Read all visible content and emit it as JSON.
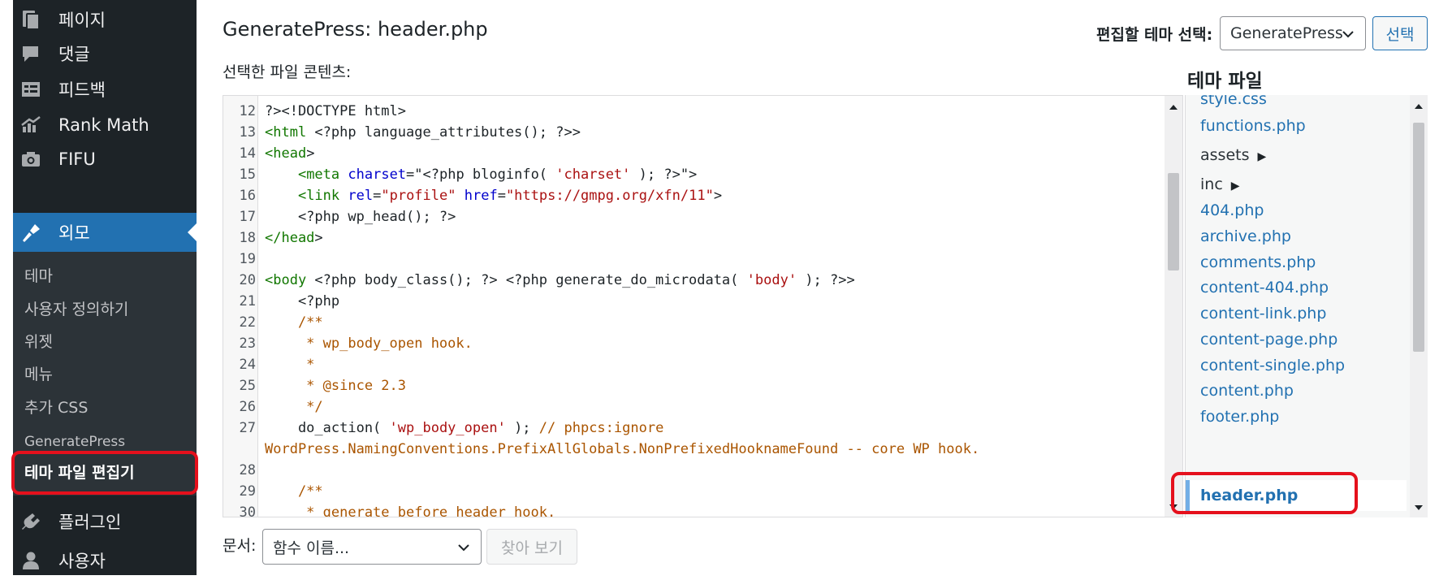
{
  "sidebar": {
    "top_items": [
      {
        "label": "페이지",
        "icon": "pages-icon"
      },
      {
        "label": "댓글",
        "icon": "comments-icon"
      },
      {
        "label": "피드백",
        "icon": "feedback-icon"
      },
      {
        "label": "Rank Math",
        "icon": "rank-math-icon"
      },
      {
        "label": "FIFU",
        "icon": "camera-icon"
      }
    ],
    "current": {
      "label": "외모",
      "icon": "appearance-brush-icon"
    },
    "submenu": [
      "테마",
      "사용자 정의하기",
      "위젯",
      "메뉴",
      "추가 CSS",
      "GeneratePress",
      "테마 파일 편집기"
    ],
    "bottom_items": [
      {
        "label": "플러그인",
        "icon": "plugins-icon"
      },
      {
        "label": "사용자",
        "icon": "users-icon"
      }
    ]
  },
  "header": {
    "title": "GeneratePress: header.php",
    "theme_select_label": "편집할 테마 선택:",
    "theme_select_value": "GeneratePress",
    "select_button": "선택"
  },
  "editor": {
    "label": "선택한 파일 콘텐츠:",
    "lines": [
      {
        "n": "12",
        "t": "?><!DOCTYPE html>"
      },
      {
        "n": "13",
        "t": "<html <?php language_attributes(); ?>>"
      },
      {
        "n": "14",
        "t": "<head>"
      },
      {
        "n": "15",
        "t": "    <meta charset=\"<?php bloginfo( 'charset' ); ?>\">"
      },
      {
        "n": "16",
        "t": "    <link rel=\"profile\" href=\"https://gmpg.org/xfn/11\">"
      },
      {
        "n": "17",
        "t": "    <?php wp_head(); ?>"
      },
      {
        "n": "18",
        "t": "</head>"
      },
      {
        "n": "19",
        "t": ""
      },
      {
        "n": "20",
        "t": "<body <?php body_class(); ?> <?php generate_do_microdata( 'body' ); ?>>"
      },
      {
        "n": "21",
        "t": "    <?php"
      },
      {
        "n": "22",
        "t": "    /**"
      },
      {
        "n": "23",
        "t": "     * wp_body_open hook."
      },
      {
        "n": "24",
        "t": "     *"
      },
      {
        "n": "25",
        "t": "     * @since 2.3"
      },
      {
        "n": "26",
        "t": "     */"
      },
      {
        "n": "27",
        "t": "    do_action( 'wp_body_open' ); // phpcs:ignore"
      },
      {
        "n": "",
        "t": "WordPress.NamingConventions.PrefixAllGlobals.NonPrefixedHooknameFound -- core WP hook."
      },
      {
        "n": "28",
        "t": ""
      },
      {
        "n": "29",
        "t": "    /**"
      },
      {
        "n": "30",
        "t": "     * generate_before_header hook."
      }
    ]
  },
  "theme_files": {
    "title": "테마 파일",
    "items": [
      {
        "label": "style.css",
        "dir": false
      },
      {
        "label": "functions.php",
        "dir": false
      },
      {
        "label": "assets",
        "dir": true
      },
      {
        "label": "inc",
        "dir": true
      },
      {
        "label": "404.php",
        "dir": false
      },
      {
        "label": "archive.php",
        "dir": false
      },
      {
        "label": "comments.php",
        "dir": false
      },
      {
        "label": "content-404.php",
        "dir": false
      },
      {
        "label": "content-link.php",
        "dir": false
      },
      {
        "label": "content-page.php",
        "dir": false
      },
      {
        "label": "content-single.php",
        "dir": false
      },
      {
        "label": "content.php",
        "dir": false
      },
      {
        "label": "footer.php",
        "dir": false
      }
    ],
    "current": "header.php"
  },
  "docs": {
    "label": "문서:",
    "placeholder": "함수 이름...",
    "lookup_button": "찾아 보기"
  },
  "colors": {
    "sidebar_bg": "#1d2327",
    "submenu_bg": "#2c3338",
    "accent": "#2271b1",
    "highlight_box": "#e5101c"
  }
}
